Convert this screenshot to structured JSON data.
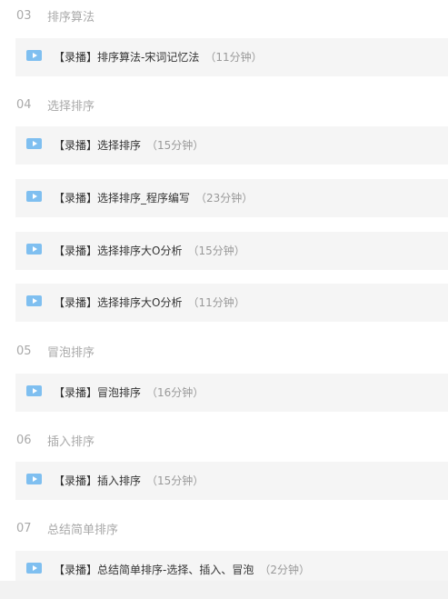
{
  "chapters": [
    {
      "number": "03",
      "title": "排序算法",
      "lessons": [
        {
          "tag": "【录播】",
          "title": "排序算法-宋词记忆法",
          "duration": "（11分钟）"
        }
      ]
    },
    {
      "number": "04",
      "title": "选择排序",
      "lessons": [
        {
          "tag": "【录播】",
          "title": "选择排序",
          "duration": "（15分钟）"
        },
        {
          "tag": "【录播】",
          "title": "选择排序_程序编写",
          "duration": "（23分钟）"
        },
        {
          "tag": "【录播】",
          "title": "选择排序大O分析",
          "duration": "（15分钟）"
        },
        {
          "tag": "【录播】",
          "title": "选择排序大O分析",
          "duration": "（11分钟）"
        }
      ]
    },
    {
      "number": "05",
      "title": "冒泡排序",
      "lessons": [
        {
          "tag": "【录播】",
          "title": "冒泡排序",
          "duration": "（16分钟）"
        }
      ]
    },
    {
      "number": "06",
      "title": "插入排序",
      "lessons": [
        {
          "tag": "【录播】",
          "title": "插入排序",
          "duration": "（15分钟）"
        }
      ]
    },
    {
      "number": "07",
      "title": "总结简单排序",
      "lessons": [
        {
          "tag": "【录播】",
          "title": "总结简单排序-选择、插入、冒泡",
          "duration": "（2分钟）"
        }
      ]
    }
  ],
  "icons": {
    "lesson_icon": "video-play-icon",
    "accent_color": "#7fbff0"
  }
}
